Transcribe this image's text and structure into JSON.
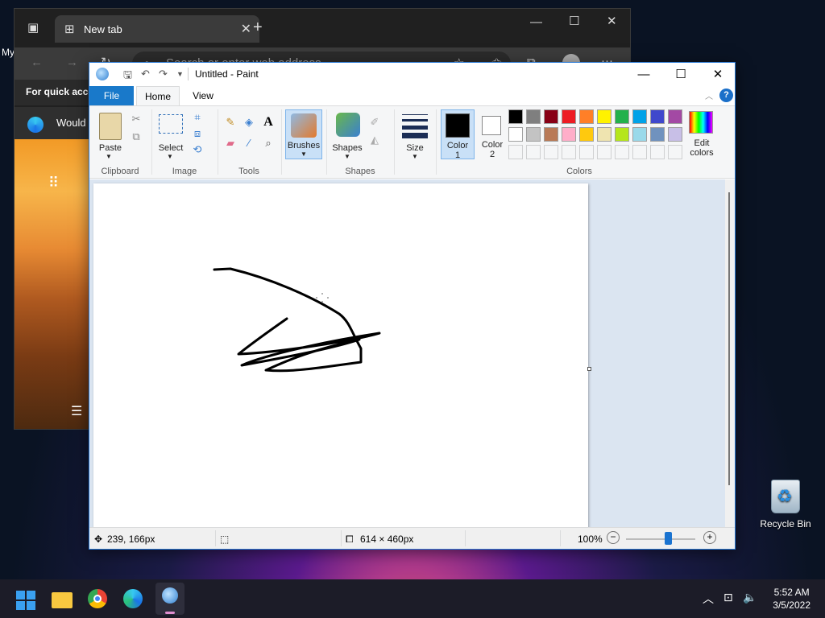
{
  "desktop": {
    "partial_label": "My",
    "recycle_bin_label": "Recycle Bin"
  },
  "browser": {
    "tab_title": "New tab",
    "address_placeholder": "Search or enter web address",
    "quick_access_text": "For quick acce",
    "would_text": "Would"
  },
  "paint": {
    "window_title": "Untitled - Paint",
    "tabs": [
      "File",
      "Home",
      "View"
    ],
    "groups": {
      "clipboard": "Clipboard",
      "image": "Image",
      "tools": "Tools",
      "shapes": "Shapes",
      "colors": "Colors"
    },
    "buttons": {
      "paste": "Paste",
      "select": "Select",
      "brushes": "Brushes",
      "shapes": "Shapes",
      "size": "Size",
      "color1_line1": "Color",
      "color1_line2": "1",
      "color2_line1": "Color",
      "color2_line2": "2",
      "edit_colors_line1": "Edit",
      "edit_colors_line2": "colors"
    },
    "palette_row1": [
      "#000000",
      "#7f7f7f",
      "#880015",
      "#ed1c24",
      "#ff7f27",
      "#fff200",
      "#22b14c",
      "#00a2e8",
      "#3f48cc",
      "#a349a4"
    ],
    "palette_row2": [
      "#ffffff",
      "#c3c3c3",
      "#b97a57",
      "#ffaec9",
      "#ffc90e",
      "#efe4b0",
      "#b5e61d",
      "#99d9ea",
      "#7092be",
      "#c8bfe7"
    ],
    "color1": "#000000",
    "color2": "#ffffff",
    "status": {
      "cursor_position": "239, 166px",
      "image_size": "614 × 460px",
      "zoom": "100%"
    }
  },
  "taskbar": {
    "time": "5:52 AM",
    "date": "3/5/2022"
  }
}
